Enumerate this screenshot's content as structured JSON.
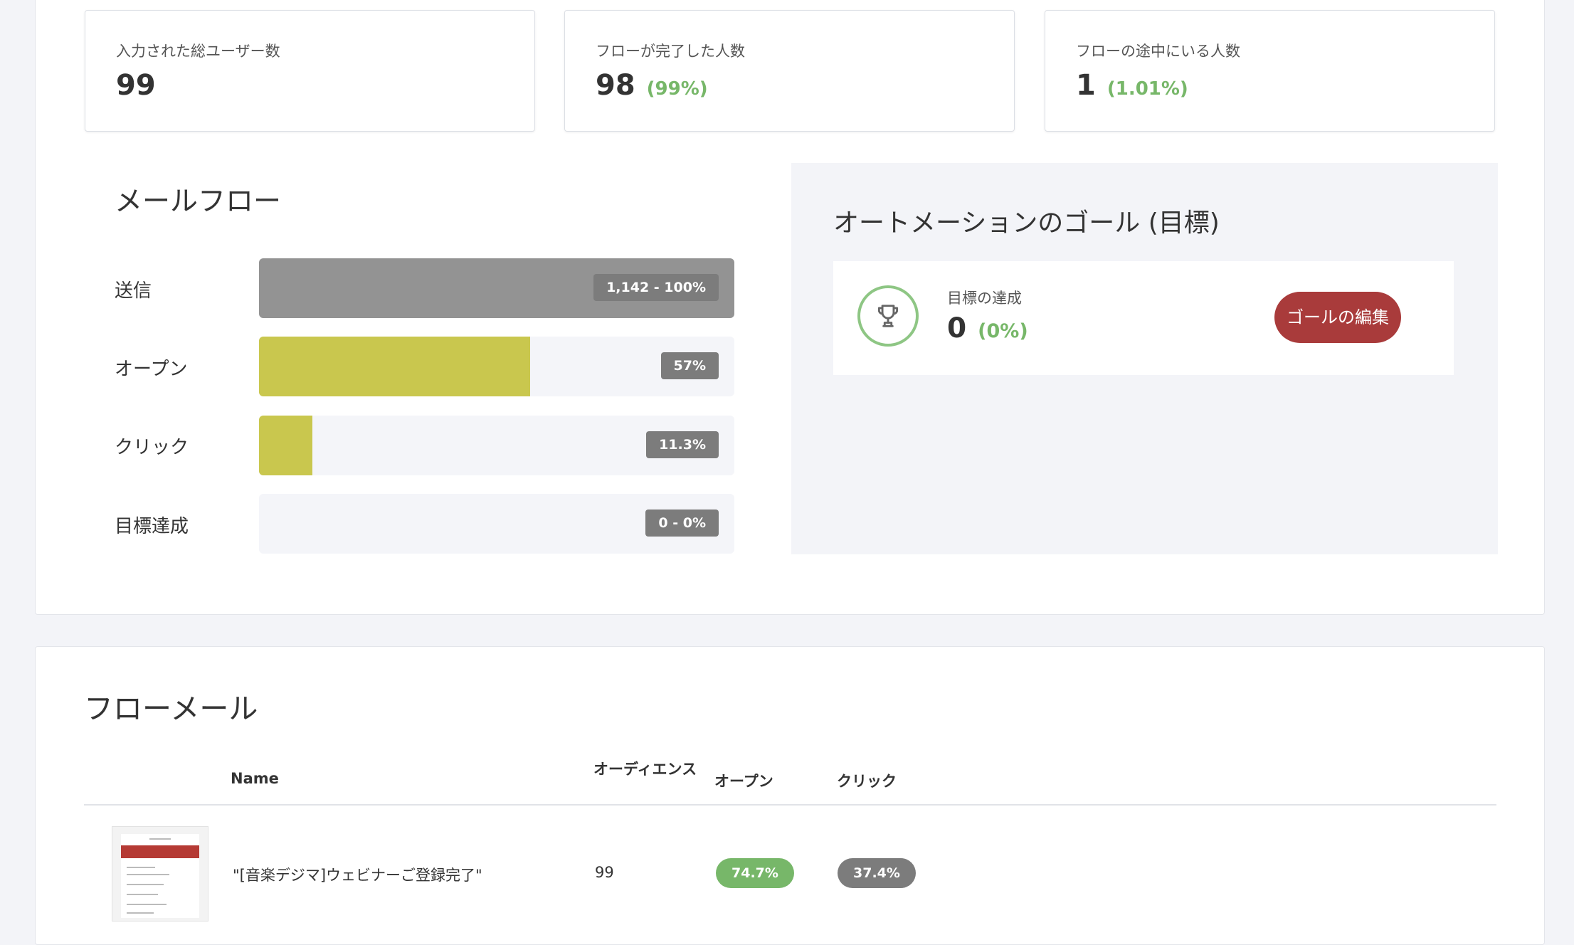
{
  "stats": [
    {
      "label": "入力された総ユーザー数",
      "value": "99",
      "pct": ""
    },
    {
      "label": "フローが完了した人数",
      "value": "98",
      "pct": "(99%)"
    },
    {
      "label": "フローの途中にいる人数",
      "value": "1",
      "pct": "(1.01%)"
    }
  ],
  "mail_flow": {
    "title": "メールフロー",
    "rows": [
      {
        "label": "送信",
        "tag": "1,142 - 100%",
        "fill": 1.0,
        "color": "#939393"
      },
      {
        "label": "オープン",
        "tag": "57%",
        "fill": 0.57,
        "color": "#c9c74e"
      },
      {
        "label": "クリック",
        "tag": "11.3%",
        "fill": 0.113,
        "color": "#c9c74e"
      },
      {
        "label": "目標達成",
        "tag": "0 - 0%",
        "fill": 0.0,
        "color": "#c9c74e"
      }
    ]
  },
  "goal": {
    "title": "オートメーションのゴール (目標)",
    "label": "目標の達成",
    "value": "0",
    "pct": "(0%)",
    "edit_button": "ゴールの編集",
    "icon": "trophy-icon"
  },
  "flow_mails": {
    "title": "フローメール",
    "columns": [
      "Name",
      "オーディエンス",
      "オープン",
      "クリック"
    ],
    "rows": [
      {
        "name": "\"[音楽デジマ]ウェビナーご登録完了\"",
        "audience": "99",
        "open": "74.7%",
        "click": "37.4%"
      }
    ]
  },
  "colors": {
    "accent_red": "#a93b3b",
    "green": "#77b769",
    "bar_gray": "#939393",
    "bar_yellow": "#c9c74e"
  }
}
